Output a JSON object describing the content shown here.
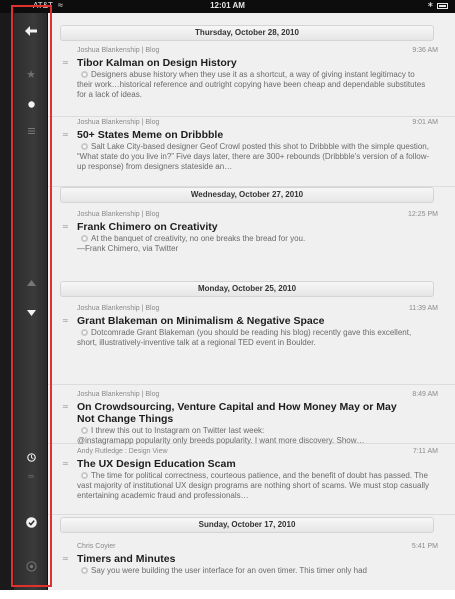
{
  "status_bar": {
    "carrier": "AT&T",
    "time": "12:01 AM"
  },
  "sidebar": {
    "buttons": [
      "back-arrow",
      "star",
      "unread-dot",
      "list",
      "up-arrow",
      "down-arrow",
      "clock",
      "rss",
      "check",
      "circle"
    ]
  },
  "groups": [
    {
      "date": "Thursday, October 28, 2010"
    },
    {
      "date": "Wednesday, October 27, 2010"
    },
    {
      "date": "Monday, October 25, 2010"
    },
    {
      "date": "Sunday, October 17, 2010"
    }
  ],
  "articles": [
    {
      "source": "Joshua Blankenship | Blog",
      "time": "9:36 AM",
      "title": "Tibor Kalman on Design History",
      "excerpt": "Designers abuse history when they use it as a shortcut, a way of giving instant legitimacy to their work…historical reference and outright copying have been cheap and dependable substitutes for a lack of ideas."
    },
    {
      "source": "Joshua Blankenship | Blog",
      "time": "9:01 AM",
      "title": "50+ States Meme on Dribbble",
      "excerpt": "Salt Lake City-based designer Geof Crowl posted this shot to Dribbble with the simple question, “What state do you live in?” Five days later, there are 300+ rebounds (Dribbble's version of a follow-up response) from designers stateside an…"
    },
    {
      "source": "Joshua Blankenship | Blog",
      "time": "12:25 PM",
      "title": "Frank Chimero on Creativity",
      "excerpt": "At the banquet of creativity, no one breaks the bread for you.\n—Frank Chimero, via Twitter"
    },
    {
      "source": "Joshua Blankenship | Blog",
      "time": "11:39 AM",
      "title": "Grant Blakeman on Minimalism & Negative Space",
      "excerpt": "Dotcomrade Grant Blakeman (you should be reading his blog) recently gave this excellent, short, illustratively-inventive talk at a regional TED event in Boulder."
    },
    {
      "source": "Joshua Blankenship | Blog",
      "time": "8:49 AM",
      "title": "On Crowdsourcing, Venture Capital and How Money May or May Not Change Things",
      "excerpt": "I threw this out to Instagram on Twitter last week:\n@instagramapp popularity only breeds popularity. I want more discovery. Show…"
    },
    {
      "source": "Andy Rutledge : Design View",
      "time": "7:11 AM",
      "title": "The UX Design Education Scam",
      "excerpt": "The time for political correctness, courteous patience, and the benefit of doubt has passed. The vast majority of institutional UX design programs are nothing short of scams. We must stop casually entertaining academic fraud and professionals…"
    },
    {
      "source": "Chris Coyier",
      "time": "5:41 PM",
      "title": "Timers and Minutes",
      "excerpt": "Say you were building the user interface for an oven timer. This timer only had"
    }
  ]
}
